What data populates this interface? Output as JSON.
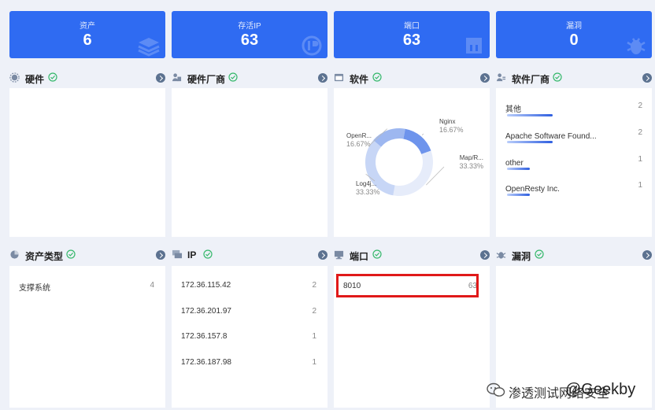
{
  "stats": [
    {
      "label": "资产",
      "value": "6"
    },
    {
      "label": "存活IP",
      "value": "63"
    },
    {
      "label": "端口",
      "value": "63"
    },
    {
      "label": "漏洞",
      "value": "0"
    }
  ],
  "panels": {
    "hardware": {
      "title": "硬件"
    },
    "hardware_vendor": {
      "title": "硬件厂商"
    },
    "software": {
      "title": "软件"
    },
    "software_vendor": {
      "title": "软件厂商"
    },
    "asset_type": {
      "title": "资产类型"
    },
    "ip": {
      "title": "IP"
    },
    "port": {
      "title": "端口"
    },
    "vuln": {
      "title": "漏洞"
    }
  },
  "chart_data": {
    "type": "pie",
    "slices": [
      {
        "label": "Nginx",
        "pct": "16.67%",
        "value": 16.67,
        "color": "#6e94ec"
      },
      {
        "label": "Map/R...",
        "pct": "33.33%",
        "value": 33.33,
        "color": "#e6ecfa"
      },
      {
        "label": "Log4j...",
        "pct": "33.33%",
        "value": 33.33,
        "color": "#c7d6f6"
      },
      {
        "label": "OpenR...",
        "pct": "16.67%",
        "value": 16.67,
        "color": "#9db7f0"
      }
    ]
  },
  "software_vendors": [
    {
      "name": "其他",
      "count": "2",
      "share": 1.0
    },
    {
      "name": "Apache Software Found...",
      "count": "2",
      "share": 1.0
    },
    {
      "name": "other",
      "count": "1",
      "share": 0.5
    },
    {
      "name": "OpenResty Inc.",
      "count": "1",
      "share": 0.5
    }
  ],
  "asset_types": [
    {
      "name": "支撑系统",
      "count": "4"
    }
  ],
  "ips": [
    {
      "ip": "172.36.115.42",
      "count": "2"
    },
    {
      "ip": "172.36.201.97",
      "count": "2"
    },
    {
      "ip": "172.36.157.8",
      "count": "1"
    },
    {
      "ip": "172.36.187.98",
      "count": "1"
    }
  ],
  "ports": [
    {
      "port": "8010",
      "count": "63"
    }
  ],
  "watermark": {
    "line1": "渗透测试网络安全",
    "line2": "@Geekby"
  },
  "colors": {
    "accent": "#2f6bf2",
    "ok": "#35b86b",
    "highlight": "#e01919"
  }
}
